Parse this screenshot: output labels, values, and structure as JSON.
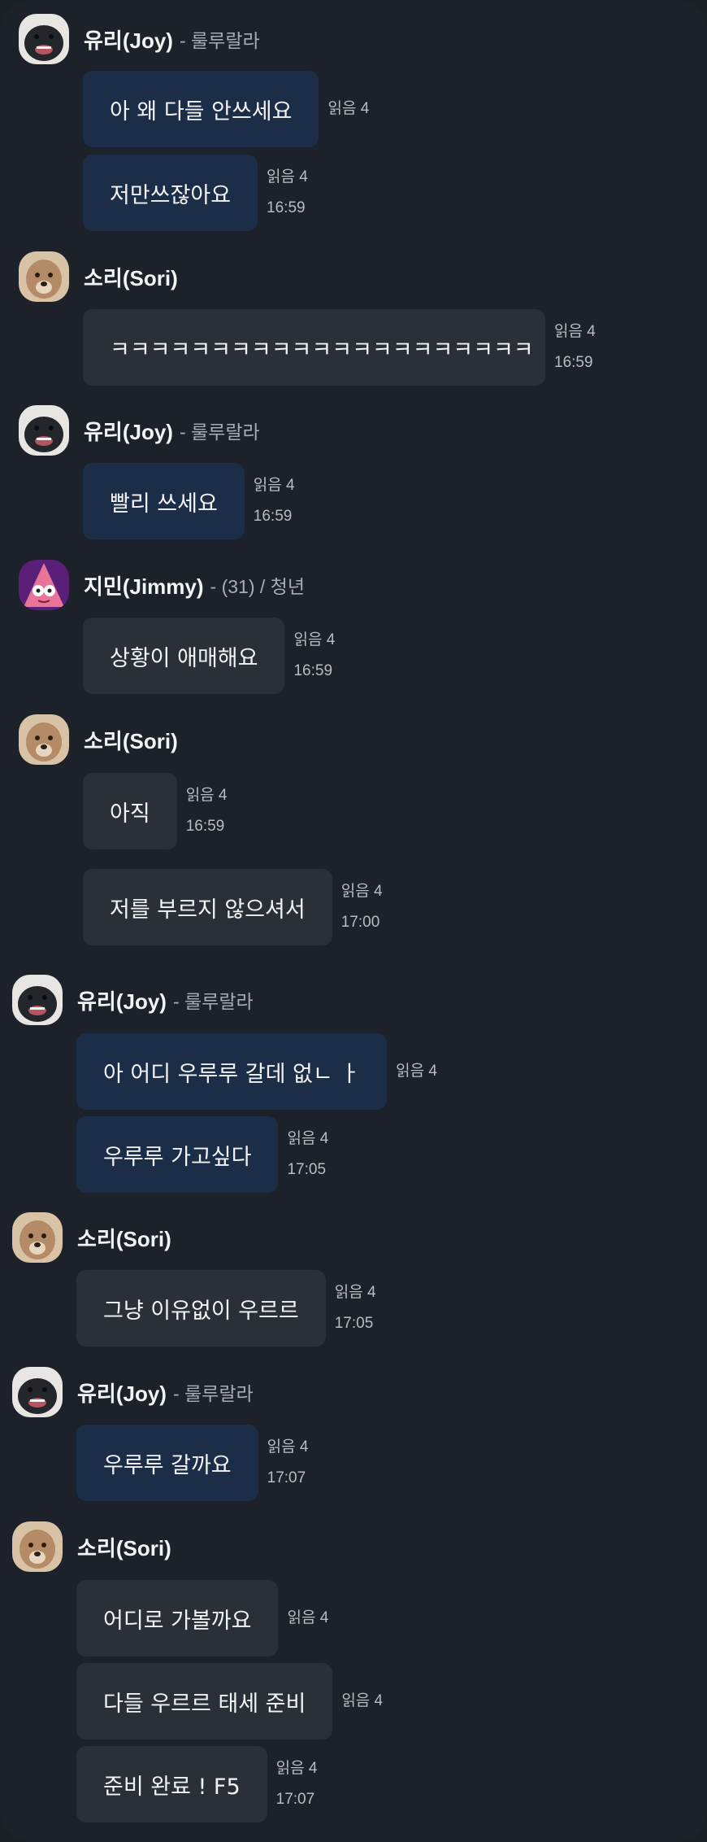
{
  "avatar_colors": {
    "joy": "#30353d",
    "sori": "#b48b66",
    "jimmy": "#8a2a90"
  },
  "chat": {
    "blocks": [
      {
        "name": "유리(Joy)",
        "meta": "- 룰루랄라",
        "avatar": "joy",
        "messages": [
          {
            "text": "아 왜 다들 안쓰세요",
            "read": "읽음 4",
            "time": ""
          },
          {
            "text": "저만쓰잖아요",
            "read": "읽음 4",
            "time": "16:59"
          }
        ]
      },
      {
        "name": "소리(Sori)",
        "meta": "",
        "avatar": "sori",
        "messages": [
          {
            "text": "ㅋㅋㅋㅋㅋㅋㅋㅋㅋㅋㅋㅋㅋㅋㅋㅋㅋㅋㅋㅋㅋ",
            "read": "읽음 4",
            "time": "16:59"
          }
        ]
      },
      {
        "name": "유리(Joy)",
        "meta": "- 룰루랄라",
        "avatar": "joy",
        "messages": [
          {
            "text": "빨리 쓰세요",
            "read": "읽음 4",
            "time": "16:59"
          }
        ]
      },
      {
        "name": "지민(Jimmy)",
        "meta": "- (31) / 청년",
        "avatar": "jimmy",
        "messages": [
          {
            "text": "상황이 애매해요",
            "read": "읽음 4",
            "time": "16:59"
          }
        ]
      },
      {
        "name": "소리(Sori)",
        "meta": "",
        "avatar": "sori",
        "messages": [
          {
            "text": "아직",
            "read": "읽음 4",
            "time": "16:59"
          },
          {
            "text": "저를 부르지 않으셔서",
            "read": "읽음 4",
            "time": "17:00"
          }
        ]
      },
      {
        "name": "유리(Joy)",
        "meta": "- 룰루랄라",
        "avatar": "joy",
        "messages": [
          {
            "text": "아 어디 우루루 갈데 없ㄴ ㅏ",
            "read": "읽음 4",
            "time": ""
          },
          {
            "text": "우루루 가고싶다",
            "read": "읽음 4",
            "time": "17:05"
          }
        ]
      },
      {
        "name": "소리(Sori)",
        "meta": "",
        "avatar": "sori",
        "messages": [
          {
            "text": "그냥 이유없이 우르르",
            "read": "읽음 4",
            "time": "17:05"
          }
        ]
      },
      {
        "name": "유리(Joy)",
        "meta": "- 룰루랄라",
        "avatar": "joy",
        "messages": [
          {
            "text": "우루루 갈까요",
            "read": "읽음 4",
            "time": "17:07"
          }
        ]
      },
      {
        "name": "소리(Sori)",
        "meta": "",
        "avatar": "sori",
        "messages": [
          {
            "text": "어디로 가볼까요",
            "read": "읽음 4",
            "time": ""
          },
          {
            "text": "다들 우르르 태세 준비",
            "read": "읽음 4",
            "time": ""
          },
          {
            "text": "준비 완료 ! F5",
            "read": "읽음 4",
            "time": "17:07"
          }
        ]
      }
    ]
  }
}
